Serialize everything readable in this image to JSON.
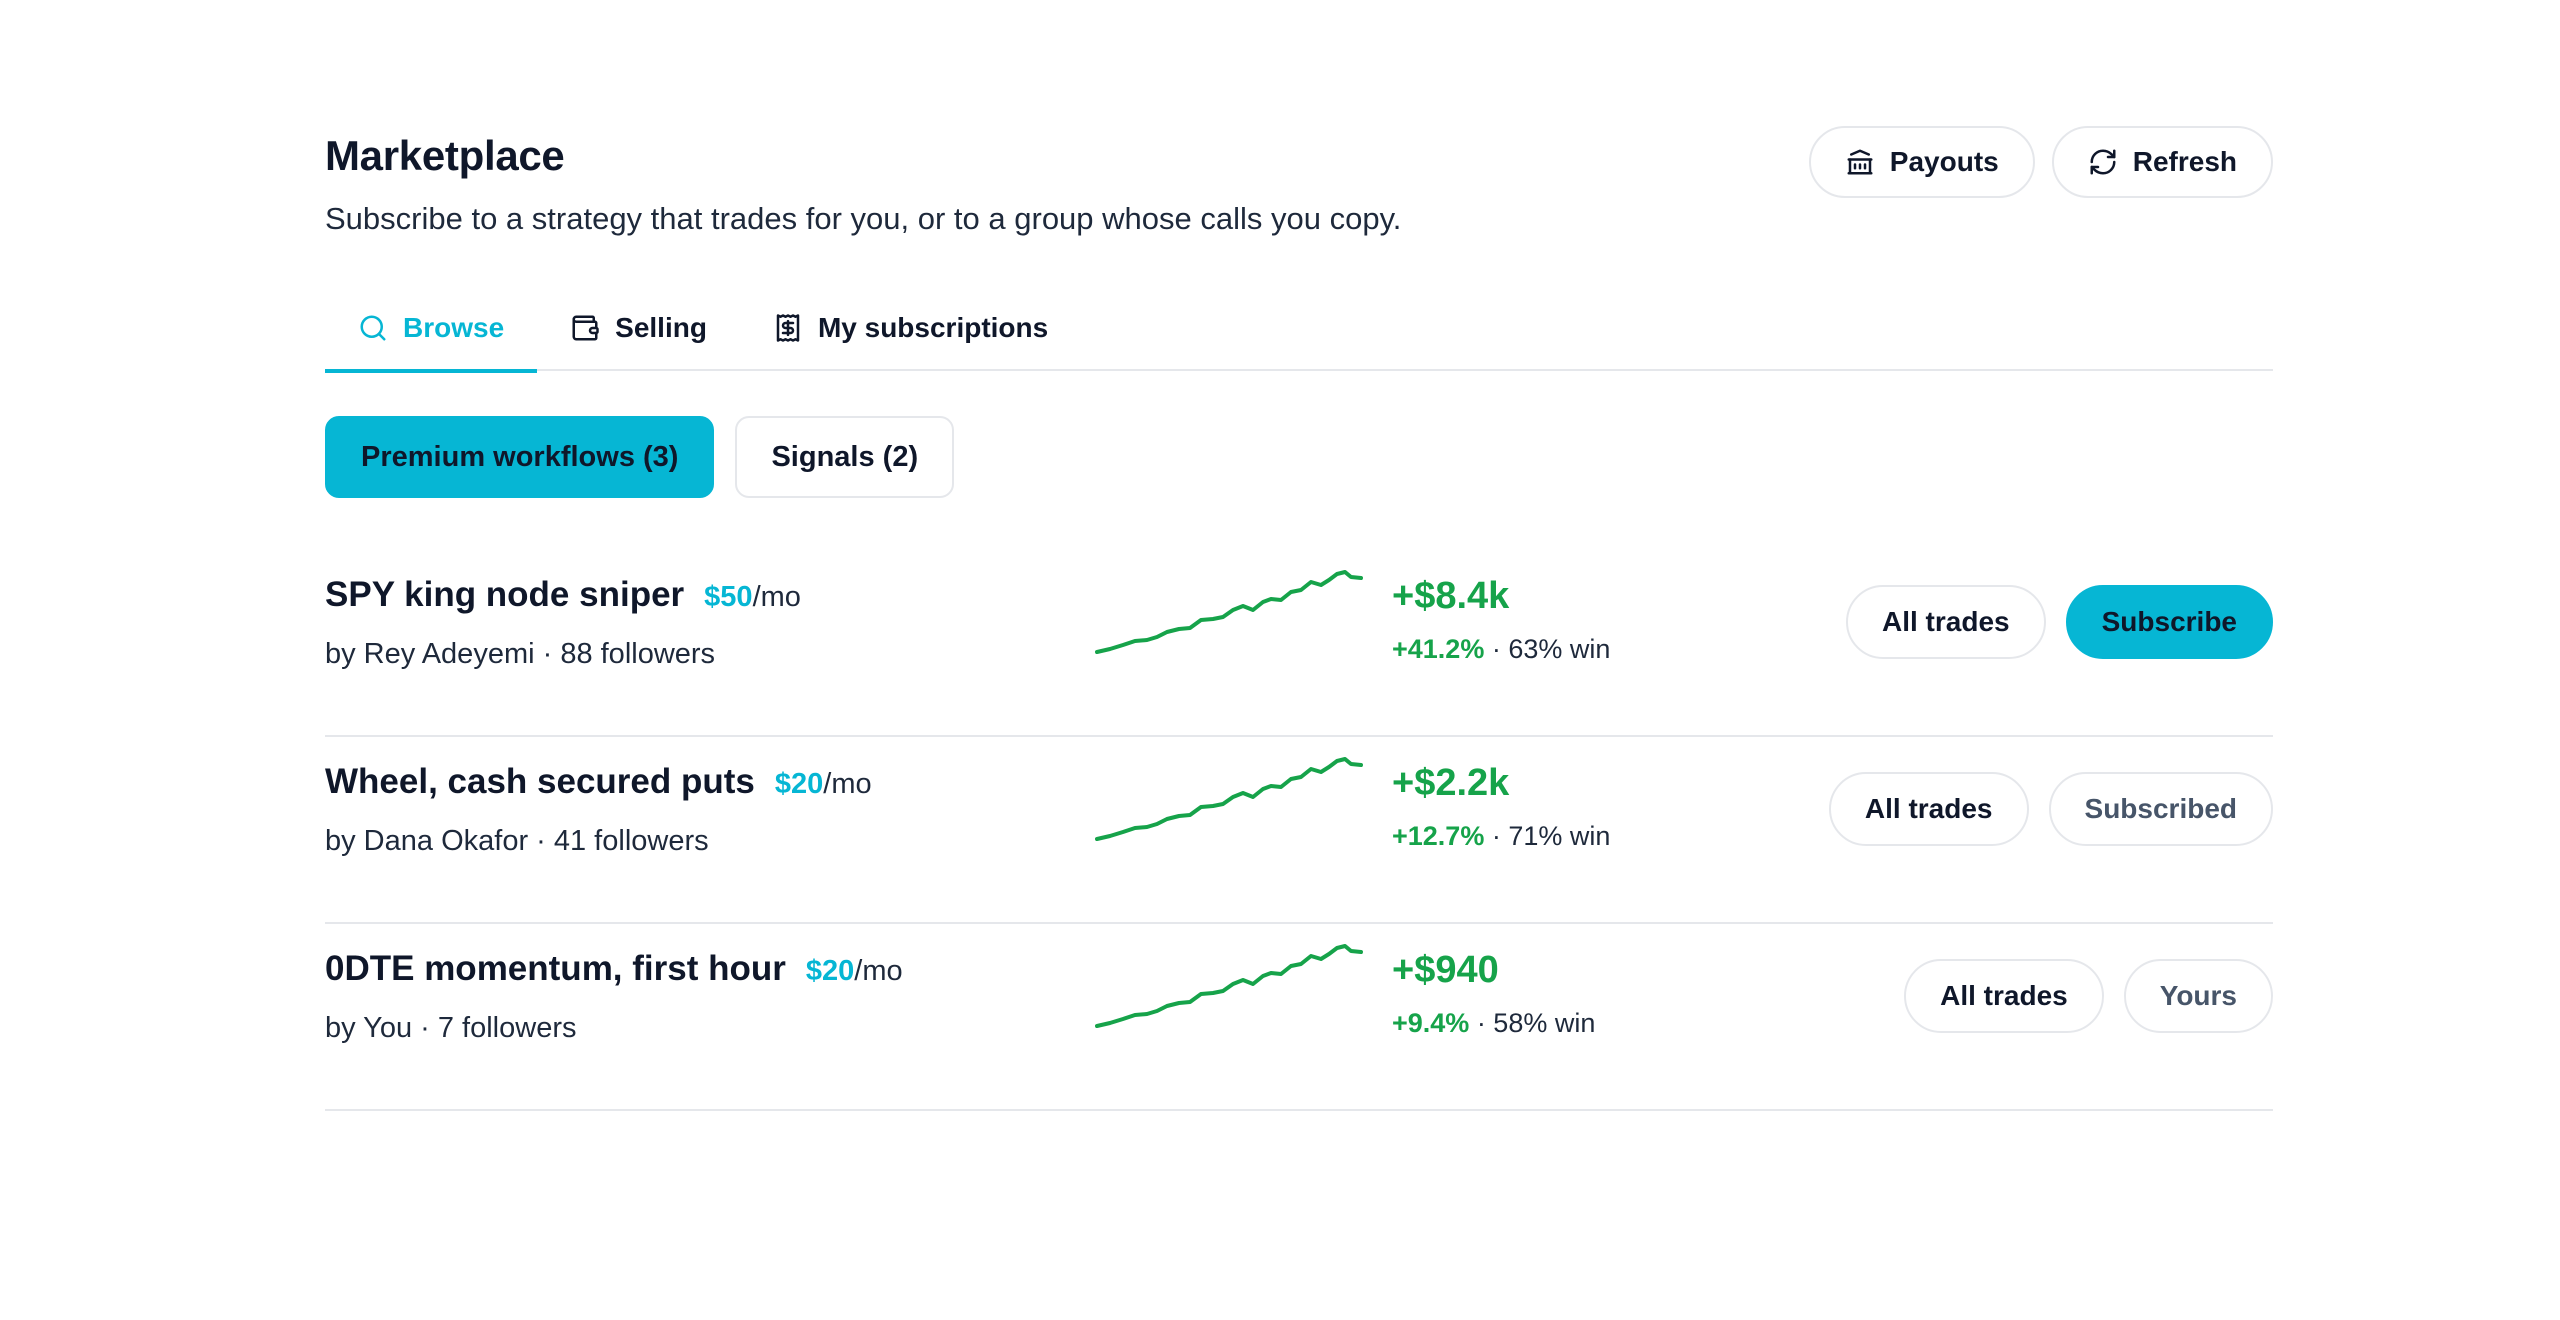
{
  "header": {
    "title": "Marketplace",
    "subtitle": "Subscribe to a strategy that trades for you, or to a group whose calls you copy.",
    "payouts_label": "Payouts",
    "refresh_label": "Refresh"
  },
  "tabs": [
    {
      "label": "Browse",
      "icon": "search-icon",
      "active": true
    },
    {
      "label": "Selling",
      "icon": "wallet-icon",
      "active": false
    },
    {
      "label": "My subscriptions",
      "icon": "receipt-icon",
      "active": false
    }
  ],
  "segments": [
    {
      "label": "Premium workflows (3)",
      "active": true
    },
    {
      "label": "Signals (2)",
      "active": false
    }
  ],
  "colors": {
    "accent": "#06b6d4",
    "positive": "#16a34a",
    "border": "#e5e7eb"
  },
  "listings": [
    {
      "name": "SPY king node sniper",
      "price": "$50",
      "per": "/mo",
      "meta": "by Rey Adeyemi · 88 followers",
      "pnl": "+$8.4k",
      "pct": "+41.2%",
      "win": " · 63% win",
      "all_trades_label": "All trades",
      "action_label": "Subscribe",
      "action_style": "primary"
    },
    {
      "name": "Wheel, cash secured puts",
      "price": "$20",
      "per": "/mo",
      "meta": "by Dana Okafor · 41 followers",
      "pnl": "+$2.2k",
      "pct": "+12.7%",
      "win": " · 71% win",
      "all_trades_label": "All trades",
      "action_label": "Subscribed",
      "action_style": "muted"
    },
    {
      "name": "0DTE momentum, first hour",
      "price": "$20",
      "per": "/mo",
      "meta": "by You · 7 followers",
      "pnl": "+$940",
      "pct": "+9.4%",
      "win": " · 58% win",
      "all_trades_label": "All trades",
      "action_label": "Yours",
      "action_style": "muted"
    }
  ]
}
